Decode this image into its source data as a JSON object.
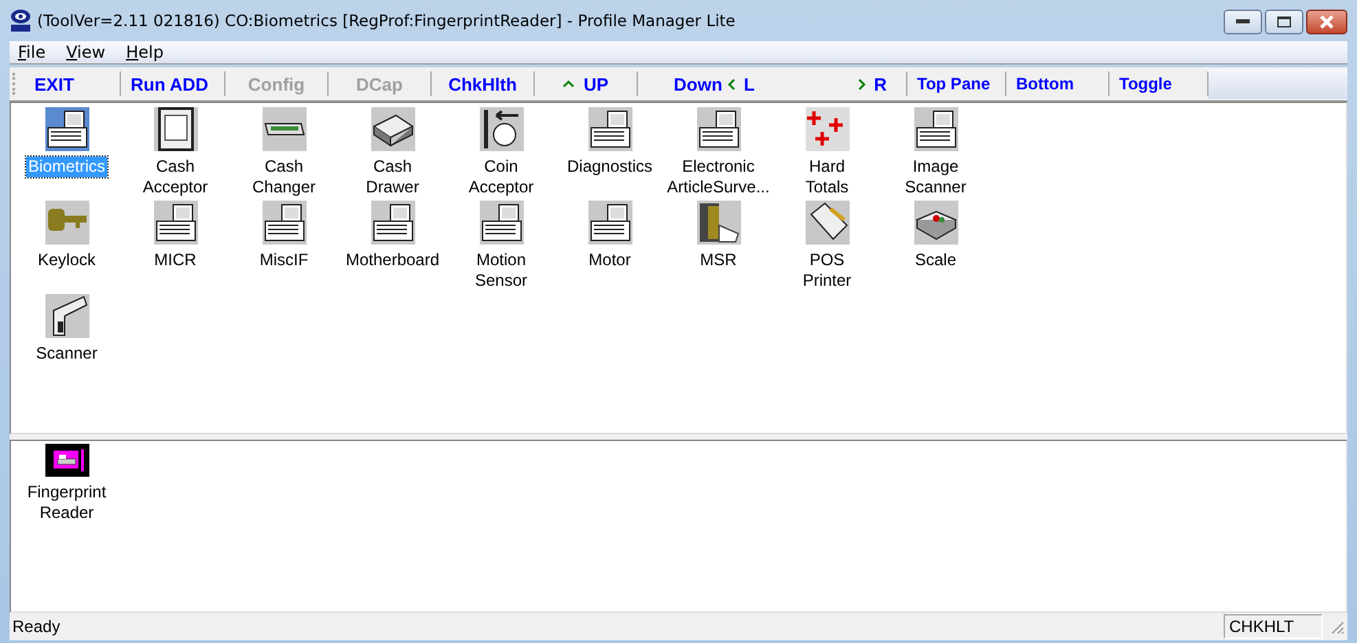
{
  "window": {
    "title": "(ToolVer=2.11 021816) CO:Biometrics [RegProf:FingerprintReader] - Profile Manager Lite"
  },
  "menu": [
    {
      "label": "File"
    },
    {
      "label": "View"
    },
    {
      "label": "Help"
    }
  ],
  "toolbar": [
    {
      "label": "EXIT",
      "kind": "plain",
      "disabled": false
    },
    {
      "label": "Run ADD",
      "kind": "plain",
      "disabled": false
    },
    {
      "label": "Config",
      "kind": "plain",
      "disabled": true
    },
    {
      "label": "DCap",
      "kind": "plain",
      "disabled": true
    },
    {
      "label": "ChkHlth",
      "kind": "plain",
      "disabled": false
    },
    {
      "label": "UP",
      "kind": "up",
      "disabled": false
    },
    {
      "label": "Down",
      "kind": "down",
      "disabled": false
    },
    {
      "label": "L",
      "kind": "left",
      "disabled": false
    },
    {
      "label": "R",
      "kind": "right",
      "disabled": false
    },
    {
      "label": "Top Pane",
      "kind": "plain",
      "disabled": false
    },
    {
      "label": "Bottom",
      "kind": "plain",
      "disabled": false
    },
    {
      "label": "Toggle",
      "kind": "plain",
      "disabled": false
    }
  ],
  "top_pane": {
    "items": [
      {
        "label": "Biometrics",
        "kind": "terminal-blue",
        "selected": true
      },
      {
        "label": "Cash Acceptor",
        "kind": "banknote",
        "selected": false
      },
      {
        "label": "Cash Changer",
        "kind": "changer",
        "selected": false
      },
      {
        "label": "Cash Drawer",
        "kind": "drawer",
        "selected": false
      },
      {
        "label": "Coin Acceptor",
        "kind": "coin",
        "selected": false
      },
      {
        "label": "Diagnostics",
        "kind": "terminal",
        "selected": false
      },
      {
        "label": "Electronic ArticleSurve...",
        "kind": "terminal",
        "selected": false
      },
      {
        "label": "Hard Totals",
        "kind": "crosses",
        "selected": false
      },
      {
        "label": "Image Scanner",
        "kind": "terminal",
        "selected": false
      },
      {
        "label": "Keylock",
        "kind": "key",
        "selected": false
      },
      {
        "label": "MICR",
        "kind": "terminal",
        "selected": false
      },
      {
        "label": "MiscIF",
        "kind": "terminal",
        "selected": false
      },
      {
        "label": "Motherboard",
        "kind": "terminal",
        "selected": false
      },
      {
        "label": "Motion Sensor",
        "kind": "terminal",
        "selected": false
      },
      {
        "label": "Motor",
        "kind": "terminal",
        "selected": false
      },
      {
        "label": "MSR",
        "kind": "msr",
        "selected": false
      },
      {
        "label": "POS Printer",
        "kind": "printer",
        "selected": false
      },
      {
        "label": "Scale",
        "kind": "scale",
        "selected": false
      },
      {
        "label": "Scanner",
        "kind": "scanner",
        "selected": false
      }
    ]
  },
  "bottom_pane": {
    "items": [
      {
        "label": "Fingerprint Reader",
        "kind": "fingerprint",
        "selected": false
      }
    ]
  },
  "status_bar": {
    "message": "Ready",
    "panel": "CHKHLT"
  }
}
